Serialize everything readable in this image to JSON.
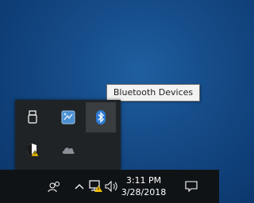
{
  "tooltip": {
    "text": "Bluetooth Devices"
  },
  "overflow_tray": {
    "icons": [
      {
        "name": "usb-drive-icon"
      },
      {
        "name": "network-app-icon"
      },
      {
        "name": "bluetooth-icon"
      },
      {
        "name": "security-shield-icon"
      },
      {
        "name": "onedrive-cloud-icon"
      }
    ]
  },
  "taskbar": {
    "time": "3:11 PM",
    "date": "3/28/2018",
    "icons": [
      "people-icon",
      "chevron-up-icon",
      "network-warning-icon",
      "volume-icon",
      "action-center-icon"
    ]
  },
  "colors": {
    "wallpaper": "#164d8a",
    "taskbar": "#101316",
    "tray_panel": "#202325",
    "bluetooth": "#2d7bd6",
    "warning": "#f2c200"
  }
}
